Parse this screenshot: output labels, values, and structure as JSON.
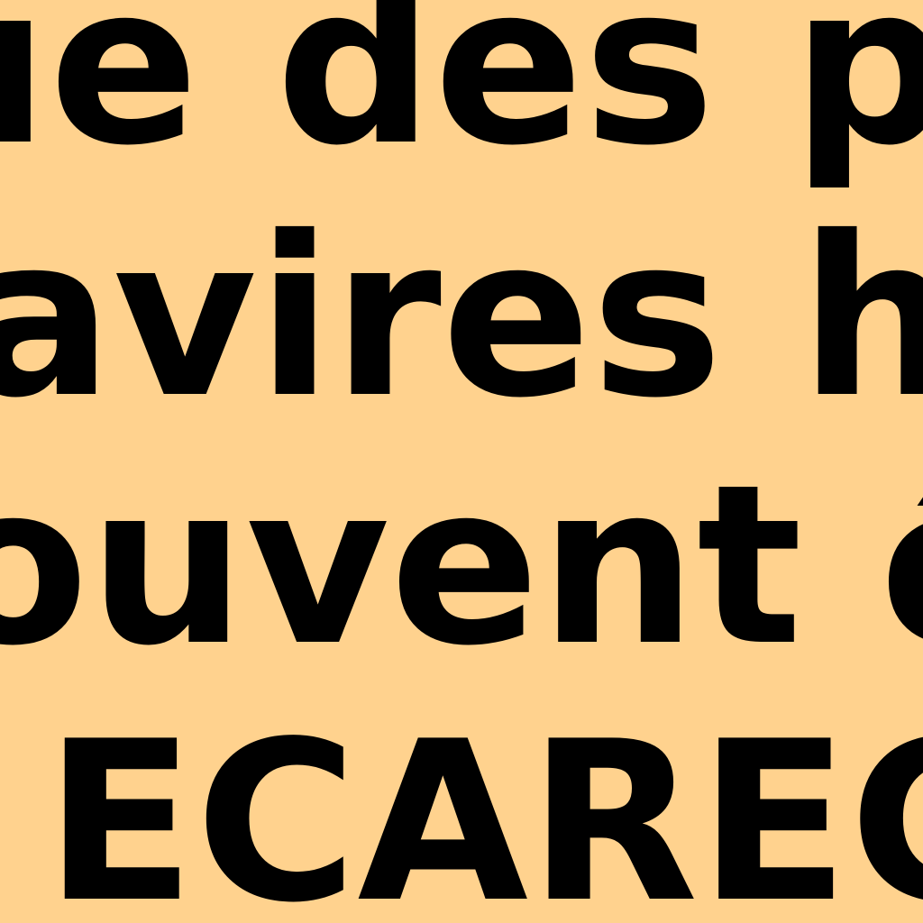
{
  "document": {
    "lines": [
      "ue des pla",
      "avires hyd",
      "ouvent êtr",
      "l ECAREC"
    ]
  },
  "colors": {
    "background": "#FFD28E",
    "text": "#000000"
  }
}
